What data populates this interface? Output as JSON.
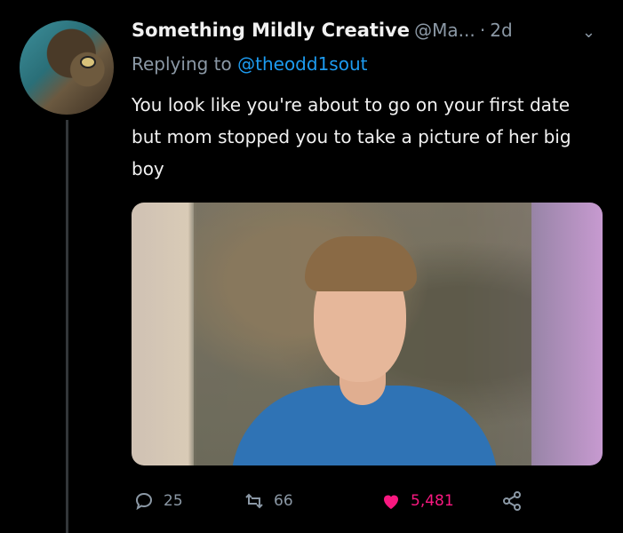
{
  "tweet": {
    "display_name": "Something Mildly Creative",
    "handle": "@Ma...",
    "separator": "·",
    "time": "2d",
    "reply_prefix": "Replying to",
    "reply_mention": "@theodd1sout",
    "text": "You look like you're about to go on your first date but mom stopped you to take a picture of her big boy"
  },
  "actions": {
    "replies": "25",
    "retweets": "66",
    "likes": "5,481"
  },
  "colors": {
    "background": "#000000",
    "mention": "#1d9bf0",
    "like": "#f91880",
    "muted": "#8b98a5"
  }
}
